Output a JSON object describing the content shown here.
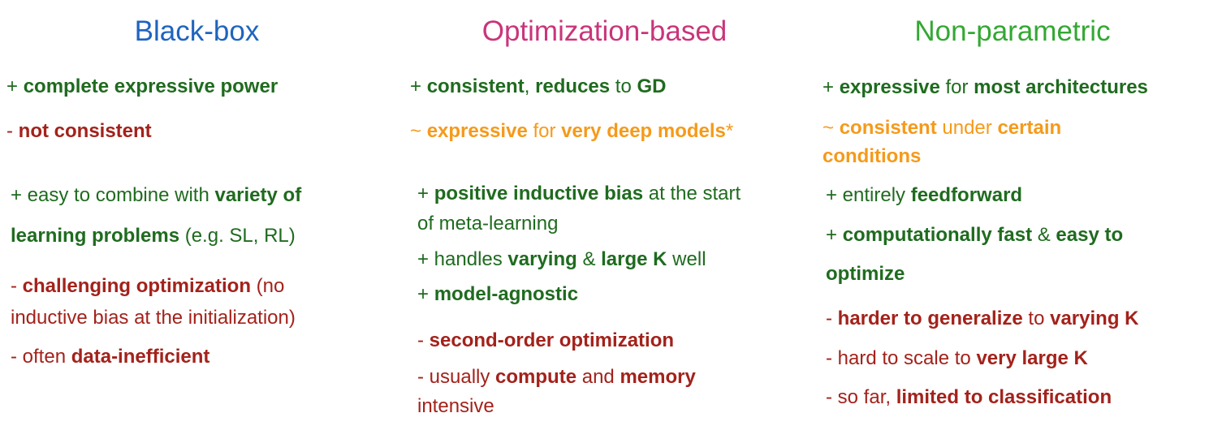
{
  "columns": [
    {
      "title": "Black-box",
      "title_color": "#1f64bf",
      "items": [
        [
          {
            "t": "+ ",
            "c": "g"
          },
          {
            "t": "complete expressive power",
            "c": "g",
            "b": true
          }
        ],
        [
          {
            "t": "- ",
            "c": "r"
          },
          {
            "t": "not consistent",
            "c": "r",
            "b": true
          }
        ],
        [
          {
            "t": "+ easy to combine with ",
            "c": "g"
          },
          {
            "t": "variety of",
            "c": "g",
            "b": true
          }
        ],
        [
          {
            "t": "learning problems",
            "c": "g",
            "b": true
          },
          {
            "t": " (e.g. SL, RL)",
            "c": "g"
          }
        ],
        [
          {
            "t": "- ",
            "c": "r"
          },
          {
            "t": "challenging optimization",
            "c": "r",
            "b": true
          },
          {
            "t": " (no",
            "c": "r"
          }
        ],
        [
          {
            "t": "inductive bias at the initialization)",
            "c": "r"
          }
        ],
        [
          {
            "t": "- often ",
            "c": "r"
          },
          {
            "t": "data-inefficient",
            "c": "r",
            "b": true
          }
        ]
      ]
    },
    {
      "title": "Optimization-based",
      "title_color": "#c9357a",
      "items": [
        [
          {
            "t": "+ ",
            "c": "g"
          },
          {
            "t": "consistent",
            "c": "g",
            "b": true
          },
          {
            "t": ", ",
            "c": "g"
          },
          {
            "t": "reduces",
            "c": "g",
            "b": true
          },
          {
            "t": " to ",
            "c": "g"
          },
          {
            "t": "GD",
            "c": "g",
            "b": true
          }
        ],
        [
          {
            "t": "~ ",
            "c": "o"
          },
          {
            "t": "expressive",
            "c": "o",
            "b": true
          },
          {
            "t": " for ",
            "c": "o"
          },
          {
            "t": "very deep models",
            "c": "o",
            "b": true
          },
          {
            "t": "*",
            "c": "o"
          }
        ],
        [
          {
            "t": "+ ",
            "c": "g"
          },
          {
            "t": "positive inductive bias",
            "c": "g",
            "b": true
          },
          {
            "t": " at the start",
            "c": "g"
          }
        ],
        [
          {
            "t": "of meta-learning",
            "c": "g"
          }
        ],
        [
          {
            "t": "+ handles ",
            "c": "g"
          },
          {
            "t": "varying",
            "c": "g",
            "b": true
          },
          {
            "t": " & ",
            "c": "g"
          },
          {
            "t": "large K",
            "c": "g",
            "b": true
          },
          {
            "t": " well",
            "c": "g"
          }
        ],
        [
          {
            "t": "+ ",
            "c": "g"
          },
          {
            "t": "model-agnostic",
            "c": "g",
            "b": true
          }
        ],
        [
          {
            "t": "- ",
            "c": "r"
          },
          {
            "t": "second-order optimization",
            "c": "r",
            "b": true
          }
        ],
        [
          {
            "t": "- usually ",
            "c": "r"
          },
          {
            "t": "compute",
            "c": "r",
            "b": true
          },
          {
            "t": " and ",
            "c": "r"
          },
          {
            "t": "memory",
            "c": "r",
            "b": true
          }
        ],
        [
          {
            "t": "intensive",
            "c": "r"
          }
        ]
      ]
    },
    {
      "title": "Non-parametric",
      "title_color": "#33a833",
      "items": [
        [
          {
            "t": "+ ",
            "c": "g"
          },
          {
            "t": "expressive",
            "c": "g",
            "b": true
          },
          {
            "t": " for ",
            "c": "g"
          },
          {
            "t": "most architectures",
            "c": "g",
            "b": true
          }
        ],
        [
          {
            "t": "~ ",
            "c": "o"
          },
          {
            "t": "consistent",
            "c": "o",
            "b": true
          },
          {
            "t": " under ",
            "c": "o"
          },
          {
            "t": "certain",
            "c": "o",
            "b": true
          }
        ],
        [
          {
            "t": "conditions",
            "c": "o",
            "b": true
          }
        ],
        [
          {
            "t": "+ entirely ",
            "c": "g"
          },
          {
            "t": "feedforward",
            "c": "g",
            "b": true
          }
        ],
        [
          {
            "t": "+ ",
            "c": "g"
          },
          {
            "t": "computationally fast",
            "c": "g",
            "b": true
          },
          {
            "t": " & ",
            "c": "g"
          },
          {
            "t": "easy to",
            "c": "g",
            "b": true
          }
        ],
        [
          {
            "t": "optimize",
            "c": "g",
            "b": true
          }
        ],
        [
          {
            "t": "- ",
            "c": "r"
          },
          {
            "t": "harder to generalize",
            "c": "r",
            "b": true
          },
          {
            "t": " to ",
            "c": "r"
          },
          {
            "t": "varying K",
            "c": "r",
            "b": true
          }
        ],
        [
          {
            "t": "- hard to scale to ",
            "c": "r"
          },
          {
            "t": "very large K",
            "c": "r",
            "b": true
          }
        ],
        [
          {
            "t": "- so far, ",
            "c": "r"
          },
          {
            "t": "limited to classification",
            "c": "r",
            "b": true
          }
        ]
      ]
    }
  ]
}
